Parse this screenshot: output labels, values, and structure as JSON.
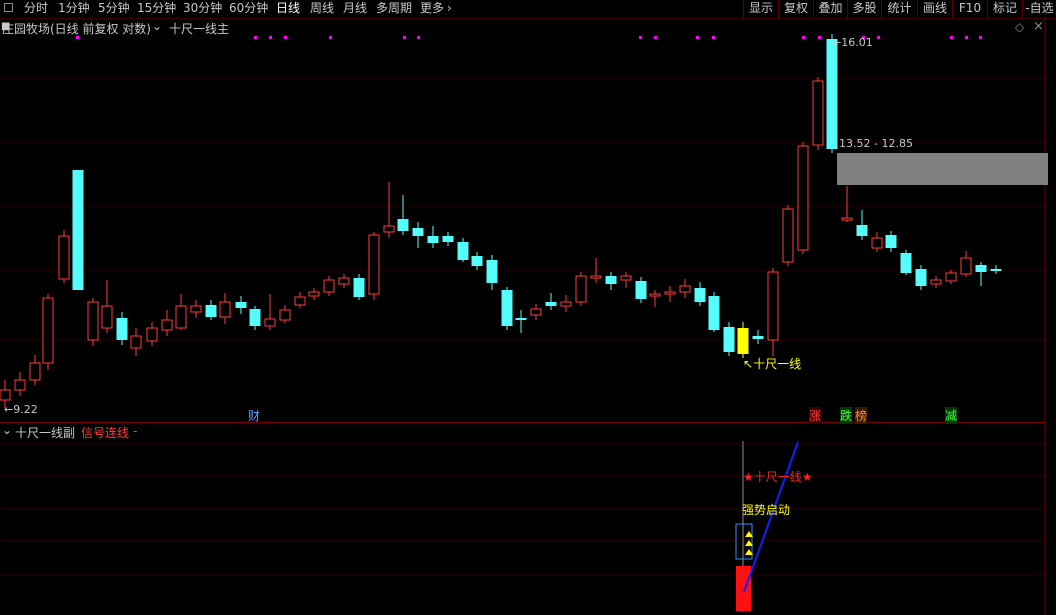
{
  "toolbar": {
    "periods": [
      "分时",
      "1分钟",
      "5分钟",
      "15分钟",
      "30分钟",
      "60分钟",
      "日线",
      "周线",
      "月线",
      "多周期",
      "更多"
    ],
    "active_period": "日线",
    "tools": [
      "显示",
      "复权",
      "叠加",
      "多股",
      "统计",
      "画线",
      "F10",
      "标记",
      "-自选"
    ]
  },
  "main_panel": {
    "title": "庄园牧场(日线 前复权 对数)",
    "indicator": "十尺一线主",
    "price_labels": {
      "high": "16.01",
      "low": "9.22"
    },
    "zone_label": "13.52 - 12.85",
    "signal_label": "十尺一线",
    "event_tags": [
      "财",
      "涨",
      "跌",
      "榜",
      "减"
    ],
    "colors": {
      "up": "#ff3c3c",
      "down": "#54fcfc",
      "zone": "#808080",
      "highlight": "#ffff00",
      "dots": "#ff00ff"
    }
  },
  "sub_panel": {
    "title": "十尺一线副",
    "signal_text": "信号连线",
    "signal_suffix": "-",
    "star_label": "★十尺一线★",
    "start_label": "强势启动"
  }
}
